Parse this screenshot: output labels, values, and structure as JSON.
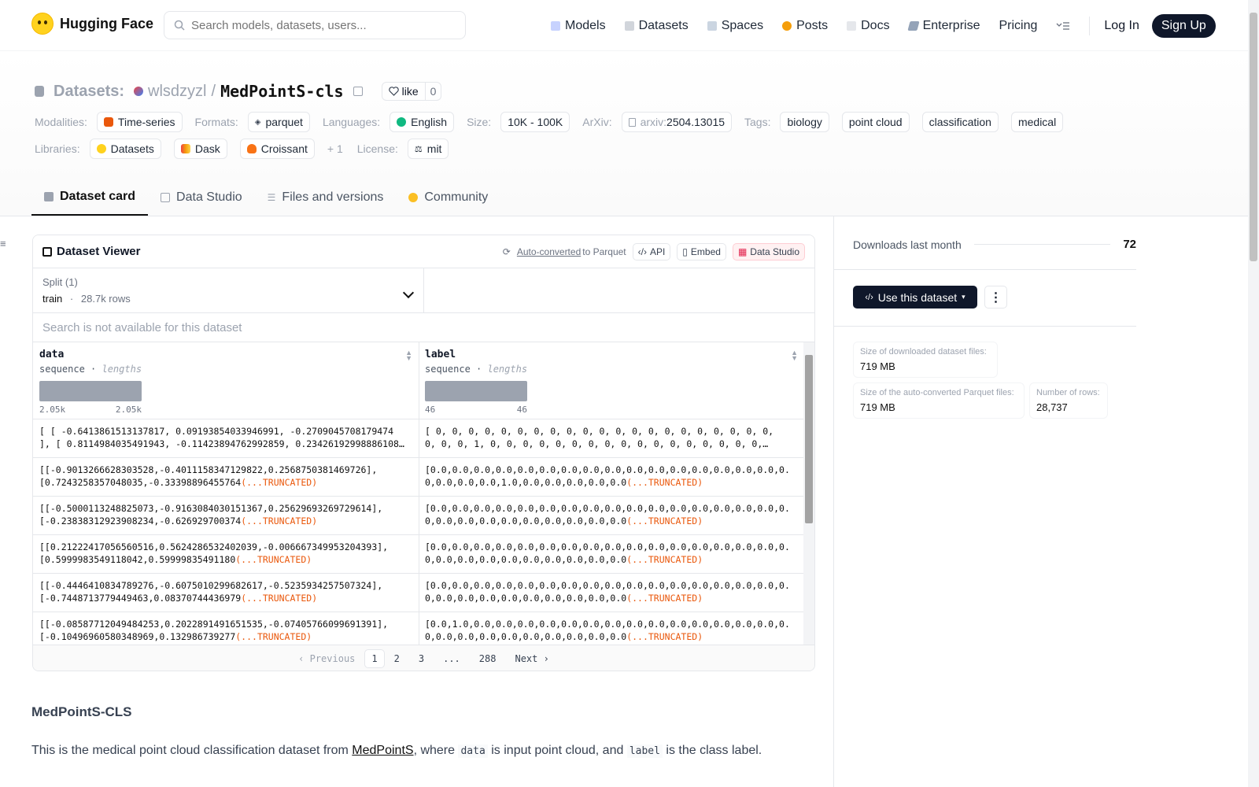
{
  "header": {
    "logo_text": "Hugging Face",
    "search_placeholder": "Search models, datasets, users...",
    "nav": [
      {
        "label": "Models"
      },
      {
        "label": "Datasets"
      },
      {
        "label": "Spaces"
      },
      {
        "label": "Posts"
      },
      {
        "label": "Docs"
      },
      {
        "label": "Enterprise"
      },
      {
        "label": "Pricing"
      }
    ],
    "login": "Log In",
    "signup": "Sign Up"
  },
  "repo": {
    "prefix": "Datasets:",
    "owner": "wlsdzyzl",
    "slash": "/",
    "name": "MedPointS-cls",
    "like_label": "like",
    "like_count": "0"
  },
  "meta": {
    "modalities_label": "Modalities:",
    "modalities": [
      "Time-series"
    ],
    "formats_label": "Formats:",
    "formats": [
      "parquet"
    ],
    "languages_label": "Languages:",
    "languages": [
      "English"
    ],
    "size_label": "Size:",
    "size": "10K - 100K",
    "arxiv_label": "ArXiv:",
    "arxiv_prefix": "arxiv:",
    "arxiv_id": "2504.13015",
    "tags_label": "Tags:",
    "tags": [
      "biology",
      "point cloud",
      "classification",
      "medical"
    ],
    "libraries_label": "Libraries:",
    "libraries": [
      "Datasets",
      "Dask",
      "Croissant"
    ],
    "libraries_more": "+ 1",
    "license_label": "License:",
    "license": "mit"
  },
  "tabs": [
    {
      "label": "Dataset card"
    },
    {
      "label": "Data Studio"
    },
    {
      "label": "Files and versions"
    },
    {
      "label": "Community"
    }
  ],
  "viewer": {
    "title": "Dataset Viewer",
    "auto_converted": "Auto-converted",
    "to_parquet": "to Parquet",
    "api": "API",
    "embed": "Embed",
    "data_studio": "Data Studio",
    "split_label": "Split (1)",
    "split_value": "train",
    "split_dot": "·",
    "split_rows": "28.7k rows",
    "search_placeholder": "Search is not available for this dataset",
    "columns": [
      {
        "name": "data",
        "type": "sequence",
        "sub": "lengths",
        "hist_min": "2.05k",
        "hist_max": "2.05k"
      },
      {
        "name": "label",
        "type": "sequence",
        "sub": "lengths",
        "hist_min": "46",
        "hist_max": "46"
      }
    ],
    "truncated": "(...TRUNCATED)",
    "rows": [
      {
        "data1": "[ [ -0.6413861513137817, 0.09193854033946991, -0.2709045708179474",
        "data2": "], [ 0.8114984035491943, -0.11423894762992859, 0.23426192998886108…",
        "data_trunc": false,
        "label1": "[ 0, 0, 0, 0, 0, 0, 0, 0, 0, 0, 0, 0, 0, 0, 0, 0, 0, 0, 0, 0, 0,",
        "label2": "0, 0, 0, 1, 0, 0, 0, 0, 0, 0, 0, 0, 0, 0, 0, 0, 0, 0, 0, 0, 0,…",
        "label_trunc": false
      },
      {
        "data1": "[[-0.9013266628303528,-0.4011158347129822,0.2568750381469726],",
        "data2": "[0.7243258357048035,-0.33398896455764",
        "data_trunc": true,
        "label1": "[0.0,0.0,0.0,0.0,0.0,0.0,0.0,0.0,0.0,0.0,0.0,0.0,0.0,0.0,0.0,0.0,0.",
        "label2": "0,0.0,0.0,0.0,1.0,0.0,0.0,0.0,0.0,0.0",
        "label_trunc": true
      },
      {
        "data1": "[[-0.5000113248825073,-0.9163084030151367,0.25629693269729614],",
        "data2": "[-0.23838312923908234,-0.626929700374",
        "data_trunc": true,
        "label1": "[0.0,0.0,0.0,0.0,0.0,0.0,0.0,0.0,0.0,0.0,0.0,0.0,0.0,0.0,0.0,0.0,0.",
        "label2": "0,0.0,0.0,0.0,0.0,0.0,0.0,0.0,0.0,0.0",
        "label_trunc": true
      },
      {
        "data1": "[[0.21222417056560516,0.5624286532402039,-0.006667349953204393],",
        "data2": "[0.5999983549118042,0.59999835491180",
        "data_trunc": true,
        "label1": "[0.0,0.0,0.0,0.0,0.0,0.0,0.0,0.0,0.0,0.0,0.0,0.0,0.0,0.0,0.0,0.0,0.",
        "label2": "0,0.0,0.0,0.0,0.0,0.0,0.0,0.0,0.0,0.0",
        "label_trunc": true
      },
      {
        "data1": "[[-0.4446410834789276,-0.6075010299682617,-0.5235934257507324],",
        "data2": "[-0.7448713779449463,0.08370744436979",
        "data_trunc": true,
        "label1": "[0.0,0.0,0.0,0.0,0.0,0.0,0.0,0.0,0.0,0.0,0.0,0.0,0.0,0.0,0.0,0.0,0.",
        "label2": "0,0.0,0.0,0.0,0.0,0.0,0.0,0.0,0.0,0.0",
        "label_trunc": true
      },
      {
        "data1": "[[-0.08587712049484253,0.2022891491651535,-0.07405766099691391],",
        "data2": "[-0.10496960580348969,0.132986739277",
        "data_trunc": true,
        "label1": "[0.0,1.0,0.0,0.0,0.0,0.0,0.0,0.0,0.0,0.0,0.0,0.0,0.0,0.0,0.0,0.0,0.",
        "label2": "0,0.0,0.0,0.0,0.0,0.0,0.0,0.0,0.0,0.0",
        "label_trunc": true
      }
    ],
    "pager": {
      "prev": "Previous",
      "pages": [
        "1",
        "2",
        "3",
        "...",
        "288"
      ],
      "next": "Next"
    }
  },
  "card": {
    "heading": "MedPointS-CLS",
    "p_before": "This is the medical point cloud classification dataset from ",
    "p_link": "MedPointS",
    "p_mid1": ", where ",
    "p_code1": "data",
    "p_mid2": " is input point cloud, and ",
    "p_code2": "label",
    "p_after": " is the class label."
  },
  "sidebar": {
    "downloads_label": "Downloads last month",
    "downloads_value": "72",
    "use_button": "Use this dataset",
    "stats": [
      {
        "label": "Size of downloaded dataset files:",
        "value": "719 MB"
      },
      {
        "label": "Size of the auto-converted Parquet files:",
        "value": "719 MB"
      },
      {
        "label": "Number of rows:",
        "value": "28,737"
      }
    ]
  },
  "colors": {
    "accent": "#0f172a",
    "truncated": "#ea580c",
    "hf_yellow": "#ffd21e"
  }
}
